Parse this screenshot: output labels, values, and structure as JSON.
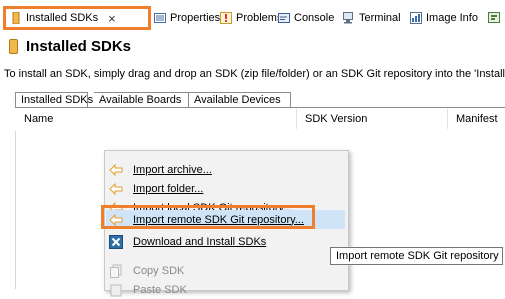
{
  "tabs": [
    {
      "label": "Installed SDKs",
      "icon": "sdk-icon",
      "active": true
    },
    {
      "label": "Properties",
      "icon": "properties-icon"
    },
    {
      "label": "Problems",
      "icon": "problems-icon"
    },
    {
      "label": "Console",
      "icon": "console-icon"
    },
    {
      "label": "Terminal",
      "icon": "terminal-icon"
    },
    {
      "label": "Image Info",
      "icon": "image-info-icon"
    }
  ],
  "close_glyph": "×",
  "view": {
    "title": "Installed SDKs",
    "description": "To install an SDK, simply drag and drop an SDK (zip file/folder) or an SDK Git repository into the 'Install"
  },
  "subtabs": [
    "Installed SDKs",
    "Available Boards",
    "Available Devices"
  ],
  "columns": [
    "Name",
    "SDK Version",
    "Manifest"
  ],
  "context_menu": [
    {
      "label": "Import archive...",
      "icon": "arrow-left-icon"
    },
    {
      "label": "Import folder...",
      "icon": "arrow-left-icon"
    },
    {
      "label": "Import local SDK Git repository...",
      "icon": "arrow-left-icon"
    },
    {
      "label": "Import remote SDK Git repository...",
      "icon": "arrow-left-icon",
      "highlighted": true
    },
    {
      "label": "Download and Install SDKs",
      "icon": "download-x-icon"
    },
    {
      "label": "Copy SDK",
      "icon": "copy-icon",
      "disabled": true
    },
    {
      "label": "Paste SDK",
      "icon": "paste-icon",
      "disabled": true
    }
  ],
  "tooltip": "Import remote SDK Git repository",
  "colors": {
    "accent_orange": "#f07f2d",
    "highlight": "#cfe4f7",
    "menu_bg": "#f2f2f2"
  }
}
